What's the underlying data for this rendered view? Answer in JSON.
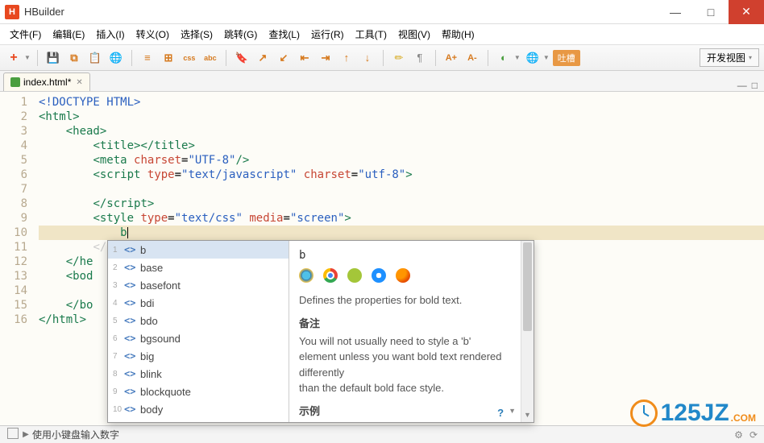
{
  "window": {
    "title": "HBuilder",
    "logo_letter": "H"
  },
  "menu": [
    "文件(F)",
    "编辑(E)",
    "插入(I)",
    "转义(O)",
    "选择(S)",
    "跳转(G)",
    "查找(L)",
    "运行(R)",
    "工具(T)",
    "视图(V)",
    "帮助(H)"
  ],
  "toolbar": {
    "new_symbol": "+",
    "buttons_raw": [
      "💾",
      "⧉",
      "📄",
      "🌐",
      "≡",
      "⊞",
      "CSS",
      "abc",
      "🔖",
      "↗",
      "↙",
      "↔",
      "↕",
      "⤢",
      "⤡",
      "✏",
      "¶",
      "A+",
      "A-",
      "⬒",
      "🌐"
    ],
    "view_label": "开发视图",
    "pill_label": "吐槽"
  },
  "tab": {
    "filename": "index.html*"
  },
  "code_lines": [
    {
      "n": 1,
      "pre": "",
      "html": "<span class='k-decl'>&lt;!DOCTYPE HTML&gt;</span>"
    },
    {
      "n": 2,
      "pre": "",
      "html": "<span class='k-tag'>&lt;html&gt;</span>"
    },
    {
      "n": 3,
      "pre": "    ",
      "html": "<span class='k-tag'>&lt;head&gt;</span>"
    },
    {
      "n": 4,
      "pre": "        ",
      "html": "<span class='k-tag'>&lt;title&gt;&lt;/title&gt;</span>"
    },
    {
      "n": 5,
      "pre": "        ",
      "html": "<span class='k-tag'>&lt;meta</span> <span class='k-attr'>charset</span>=<span class='k-str'>\"UTF-8\"</span><span class='k-tag'>/&gt;</span>"
    },
    {
      "n": 6,
      "pre": "        ",
      "html": "<span class='k-tag'>&lt;script</span> <span class='k-attr'>type</span>=<span class='k-str'>\"text/javascript\"</span> <span class='k-attr'>charset</span>=<span class='k-str'>\"utf-8\"</span><span class='k-tag'>&gt;</span>"
    },
    {
      "n": 7,
      "pre": "",
      "html": ""
    },
    {
      "n": 8,
      "pre": "        ",
      "html": "<span class='k-tag'>&lt;/script&gt;</span>"
    },
    {
      "n": 9,
      "pre": "        ",
      "html": "<span class='k-tag'>&lt;style</span> <span class='k-attr'>type</span>=<span class='k-str'>\"text/css\"</span> <span class='k-attr'>media</span>=<span class='k-str'>\"screen\"</span><span class='k-tag'>&gt;</span>"
    },
    {
      "n": 10,
      "pre": "            ",
      "html": "<span class='k-tag'>b</span><span class='cursor-caret'></span>",
      "hl": true
    },
    {
      "n": 11,
      "pre": "        ",
      "html": "<span style='color:#ccc'>&lt;/style&gt;</span>"
    },
    {
      "n": 12,
      "pre": "    ",
      "html": "<span class='k-tag'>&lt;/he</span>"
    },
    {
      "n": 13,
      "pre": "    ",
      "html": "<span class='k-tag'>&lt;bod</span>"
    },
    {
      "n": 14,
      "pre": "",
      "html": ""
    },
    {
      "n": 15,
      "pre": "    ",
      "html": "<span class='k-tag'>&lt;/bo</span>"
    },
    {
      "n": 16,
      "pre": "",
      "html": "<span class='k-tag'>&lt;/html&gt;</span>"
    }
  ],
  "autocomplete": {
    "items": [
      "b",
      "base",
      "basefont",
      "bdi",
      "bdo",
      "bgsound",
      "big",
      "blink",
      "blockquote",
      "body"
    ],
    "selected_index": 0,
    "info": {
      "title": "b",
      "description": "Defines the properties for bold text.",
      "remark_header": "备注",
      "remark_body": "You will not usually need to style a 'b' element unless you want bold text rendered differently\nthan the default bold face style.",
      "example_header": "示例"
    }
  },
  "statusbar": {
    "msg": "使用小键盘输入数字"
  },
  "watermark": {
    "text": "125JZ",
    "suffix": ".COM"
  }
}
